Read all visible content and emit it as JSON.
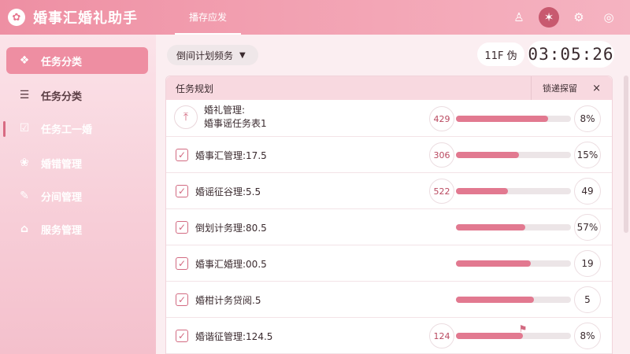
{
  "app": {
    "title": "婚事汇婚礼助手",
    "tab": "播存应发"
  },
  "header_icons": [
    "people-icon",
    "star-icon",
    "gear-icon",
    "compass-icon"
  ],
  "sidebar": {
    "items": [
      {
        "label": "任务分类",
        "icon": "palette-icon",
        "active": true
      },
      {
        "label": "任务分类",
        "icon": "list-icon",
        "active": false
      },
      {
        "label": "任务⼯⼀婚",
        "icon": "checkbox-icon",
        "active": false
      },
      {
        "label": "婚错管理",
        "icon": "flower-icon",
        "active": false
      },
      {
        "label": "分间管理",
        "icon": "edit-icon",
        "active": false
      },
      {
        "label": "服务管理",
        "icon": "home-icon",
        "active": false
      }
    ]
  },
  "main": {
    "dropdown": "倒间计划频务",
    "date": "11F 伪",
    "clock": "03:05:26"
  },
  "panel": {
    "title": "任务规划",
    "action": "锁递探留",
    "close": "×",
    "rows": [
      {
        "name": "婚礼管理:\n婚事谣任务表1",
        "badge": "429",
        "progress": 0.8,
        "pct": "8%",
        "type": "pin"
      },
      {
        "name": "婚事汇管理:17.5",
        "badge": "306",
        "progress": 0.55,
        "pct": "15%",
        "type": "check"
      },
      {
        "name": "婚谣征谷理:5.5",
        "badge": "522",
        "progress": 0.45,
        "pct": "49",
        "type": "check"
      },
      {
        "name": "倒划计务理:80.5",
        "badge": "",
        "progress": 0.6,
        "pct": "57%",
        "type": "check"
      },
      {
        "name": "婚事汇婚理:00.5",
        "badge": "",
        "progress": 0.65,
        "pct": "19",
        "type": "check"
      },
      {
        "name": "婚柑计务贷阅.5",
        "badge": "",
        "progress": 0.68,
        "pct": "5",
        "type": "check"
      },
      {
        "name": "婚谐征管理:124.5",
        "badge": "124",
        "progress": 0.58,
        "pct": "8%",
        "type": "check"
      }
    ]
  },
  "colors": {
    "accent": "#e27990",
    "titlebar": "#ee8fa3"
  }
}
